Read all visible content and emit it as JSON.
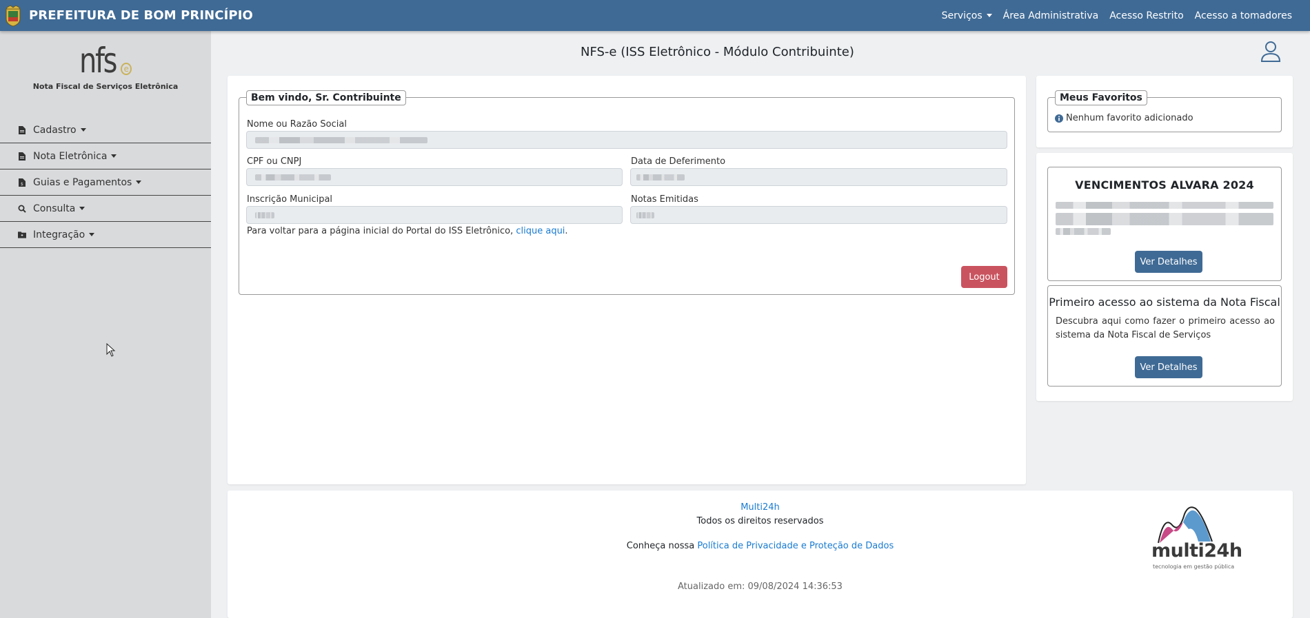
{
  "navbar": {
    "title": "PREFEITURA DE BOM PRINCÍPIO",
    "links": [
      {
        "label": "Serviços",
        "has_caret": true
      },
      {
        "label": "Área Administrativa"
      },
      {
        "label": "Acesso Restrito"
      },
      {
        "label": "Acesso a tomadores"
      }
    ]
  },
  "sidebar": {
    "logo_text": "nfs",
    "logo_e": "e",
    "logo_subtitle": "Nota Fiscal de Serviços Eletrônica",
    "items": [
      {
        "label": "Cadastro",
        "icon": "document-icon"
      },
      {
        "label": "Nota Eletrônica",
        "icon": "document-icon"
      },
      {
        "label": "Guias e Pagamentos",
        "icon": "receipt-icon"
      },
      {
        "label": "Consulta",
        "icon": "search-icon"
      },
      {
        "label": "Integração",
        "icon": "folder-icon"
      }
    ]
  },
  "main": {
    "title": "NFS-e (ISS Eletrônico - Módulo Contribuinte)"
  },
  "welcome": {
    "legend": "Bem vindo, Sr. Contribuinte",
    "name_label": "Nome ou Razão Social",
    "cpf_label": "CPF ou CNPJ",
    "deferimento_label": "Data de Deferimento",
    "inscricao_label": "Inscrição Municipal",
    "notas_label": "Notas Emitidas",
    "return_text": "Para voltar para a página inicial do Portal do ISS Eletrônico, ",
    "return_link": "clique aqui",
    "return_end": ".",
    "logout": "Logout"
  },
  "favorites": {
    "legend": "Meus Favoritos",
    "empty": "Nenhum favorito adicionado"
  },
  "alvara": {
    "title": "VENCIMENTOS ALVARA 2024",
    "button": "Ver Detalhes"
  },
  "primeiro": {
    "title": "Primeiro acesso ao sistema da Nota Fiscal",
    "text": "Descubra aqui como fazer o primeiro acesso ao sistema da Nota Fiscal de Serviços",
    "button": "Ver Detalhes"
  },
  "footer": {
    "company": "Multi24h",
    "rights": "Todos os direitos reservados",
    "privacy_prefix": "Conheça nossa ",
    "privacy_link": "Política de Privacidade e Proteção de Dados",
    "updated": "Atualizado em: 09/08/2024 14:36:53",
    "logo_text": "multi24h",
    "logo_tagline": "tecnologia em gestão pública"
  },
  "colors": {
    "navbar": "#3f6a95",
    "sidebar": "#d9dadc",
    "logout": "#c9535f",
    "link": "#1a7bd0"
  }
}
